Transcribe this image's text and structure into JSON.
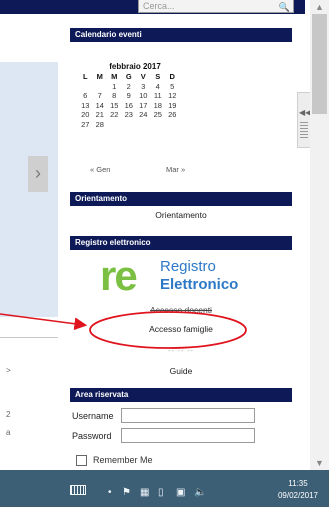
{
  "search": {
    "placeholder": "Cerca..."
  },
  "sections": {
    "calendar_header": "Calendario eventi",
    "orientamento_header": "Orientamento",
    "registro_header": "Registro elettronico",
    "riservata_header": "Area riservata"
  },
  "calendar": {
    "month": "febbraio 2017",
    "weekdays": [
      "L",
      "M",
      "M",
      "G",
      "V",
      "S",
      "D"
    ],
    "weeks": [
      [
        "",
        "",
        "1",
        "2",
        "3",
        "4",
        "5"
      ],
      [
        "6",
        "7",
        "8",
        "9",
        "10",
        "11",
        "12"
      ],
      [
        "13",
        "14",
        "15",
        "16",
        "17",
        "18",
        "19"
      ],
      [
        "20",
        "21",
        "22",
        "23",
        "24",
        "25",
        "26"
      ],
      [
        "27",
        "28",
        "",
        "",
        "",
        "",
        ""
      ]
    ],
    "prev": "« Gen",
    "next": "Mar »"
  },
  "orientamento": {
    "link": "Orientamento"
  },
  "registro": {
    "logo_mark": "re",
    "logo_line1": "Registro",
    "logo_line2": "Elettronico",
    "link_docenti": "Accesso docenti",
    "link_famiglie": "Accesso famiglie",
    "separator": "-- -- --",
    "link_guide": "Guide"
  },
  "login": {
    "username_label": "Username",
    "password_label": "Password",
    "remember_label": "Remember Me"
  },
  "left": {
    "marks": [
      ">",
      "2",
      "a"
    ]
  },
  "taskbar": {
    "time": "11:35",
    "date": "09/02/2017"
  },
  "annotation": {
    "color": "#e0141e"
  }
}
